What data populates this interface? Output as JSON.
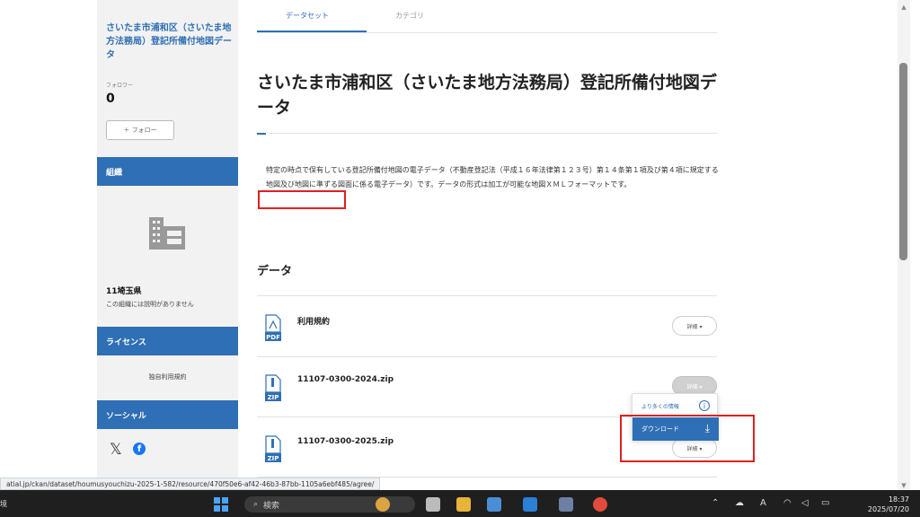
{
  "sidebar": {
    "title": "さいたま市浦和区（さいたま地方法務局）登記所備付地図データ",
    "follower_label": "フォロワー",
    "follower_count": "0",
    "follow_button": "＋ フォロー",
    "org_heading": "組織",
    "org_name": "11埼玉県",
    "org_desc": "この組織には説明がありません",
    "license_heading": "ライセンス",
    "license_text": "独自利用規約",
    "social_heading": "ソーシャル"
  },
  "tabs": [
    {
      "label": "データセット"
    },
    {
      "label": "カテゴリ"
    }
  ],
  "main": {
    "title": "さいたま市浦和区（さいたま地方法務局）登記所備付地図データ",
    "description": "特定の時点で保有している登記所備付地図の電子データ（不動産登記法（平成１６年法律第１２３号）第１４条第１項及び第４項に規定する地図及び地図に準ずる図面に係る電子データ）です。データの形式は加工が可能な地図ＸＭＬフォーマットです。",
    "data_heading": "データ"
  },
  "resources": [
    {
      "name": "利用規約",
      "format": "PDF",
      "detail": "詳細 ▾"
    },
    {
      "name": "11107-0300-2024.zip",
      "format": "ZIP",
      "detail": "詳細 ▾"
    },
    {
      "name": "11107-0300-2025.zip",
      "format": "ZIP",
      "detail": "詳細 ▾"
    }
  ],
  "dropdown": {
    "more_info": "より多くの情報",
    "download": "ダウンロード"
  },
  "status_url": "atial.jp/ckan/dataset/houmusyouchizu-2025-1-582/resource/470f50e6-af42-46b3-87bb-1105a6ebf485/agree/",
  "taskbar": {
    "left_text": "境",
    "search_placeholder": "検索",
    "time": "18:37",
    "date": "2025/07/20"
  },
  "colors": {
    "accent": "#2f6fb5",
    "highlight": "#e02020",
    "pdf": "#2f6fb5",
    "zip": "#2f6fb5"
  }
}
